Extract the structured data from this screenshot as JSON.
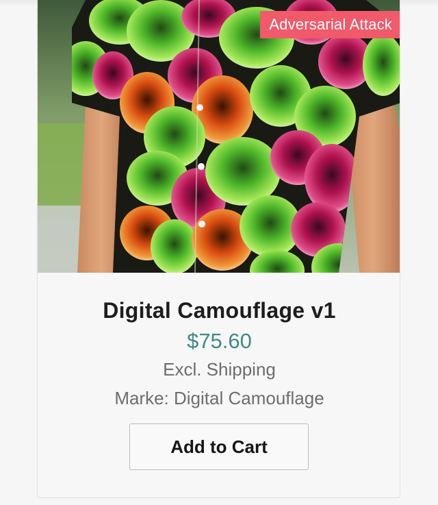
{
  "product": {
    "badge": "Adversarial Attack",
    "title": "Digital Camouflage v1",
    "price": "$75.60",
    "shipping_note": "Excl. Shipping",
    "brand_line": "Marke: Digital Camouflage",
    "add_to_cart_label": "Add to Cart",
    "image_description": "Person wearing short-sleeve shirt with green, magenta and orange blob pattern"
  },
  "colors": {
    "badge_bg": "#f05a6a",
    "price": "#3f8a86",
    "secondary_text": "#6d6d6d"
  }
}
